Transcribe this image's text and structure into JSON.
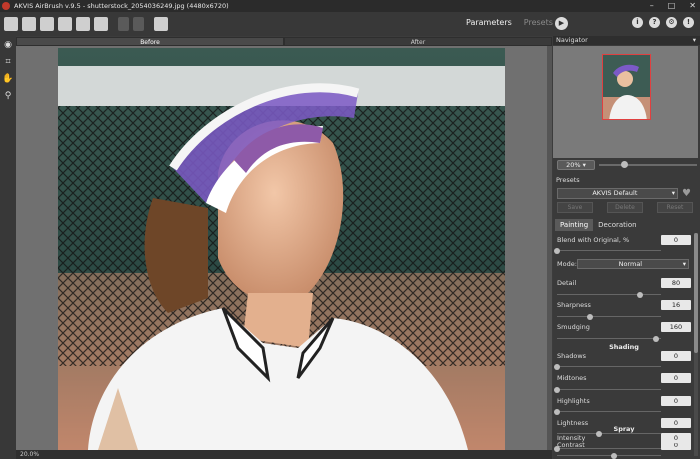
{
  "window": {
    "title": "AKVIS AirBrush v.9.5 - shutterstock_2054036249.jpg (4480x6720)"
  },
  "mode_tabs": {
    "parameters": "Parameters",
    "presets": "Presets"
  },
  "view_tabs": {
    "before": "Before",
    "after": "After"
  },
  "status": {
    "zoom": "20.0%"
  },
  "navigator": {
    "title": "Navigator",
    "zoom": "20%"
  },
  "presets": {
    "title": "Presets",
    "selected": "AKVIS Default",
    "save": "Save",
    "delete": "Delete",
    "reset": "Reset"
  },
  "param_tabs": {
    "painting": "Painting",
    "decoration": "Decoration"
  },
  "params": {
    "blend_label": "Blend with Original, %",
    "blend_value": "0",
    "mode_label": "Mode:",
    "mode_value": "Normal",
    "detail_label": "Detail",
    "detail_value": "80",
    "sharpness_label": "Sharpness",
    "sharpness_value": "16",
    "smudging_label": "Smudging",
    "smudging_value": "160",
    "shading_header": "Shading",
    "shadows_label": "Shadows",
    "shadows_value": "0",
    "midtones_label": "Midtones",
    "midtones_value": "0",
    "highlights_label": "Highlights",
    "highlights_value": "0",
    "lightness_label": "Lightness",
    "lightness_value": "0",
    "contrast_label": "Contrast",
    "contrast_value": "0",
    "spray_header": "Spray",
    "intensity_label": "Intensity",
    "intensity_value": "0"
  },
  "levels": {
    "blend": 0,
    "detail": 0.8,
    "sharpness": 0.32,
    "smudging": 0.95,
    "shadows": 0,
    "midtones": 0,
    "highlights": 0,
    "lightness": 0.4,
    "contrast": 0.55,
    "intensity": 0
  },
  "icons": [
    "open-icon",
    "open-file-icon",
    "save-icon",
    "print-icon",
    "batch-icon",
    "settings-export-icon",
    "undo-icon",
    "redo-icon",
    "apply-icon",
    "info-icon",
    "help-icon",
    "gear-icon",
    "notification-icon",
    "play-icon",
    "eye-icon",
    "crop-icon",
    "hand-icon",
    "zoom-icon",
    "heart-icon"
  ],
  "colors": {
    "accent": "#c0392b",
    "background": "#3c3c3c"
  }
}
